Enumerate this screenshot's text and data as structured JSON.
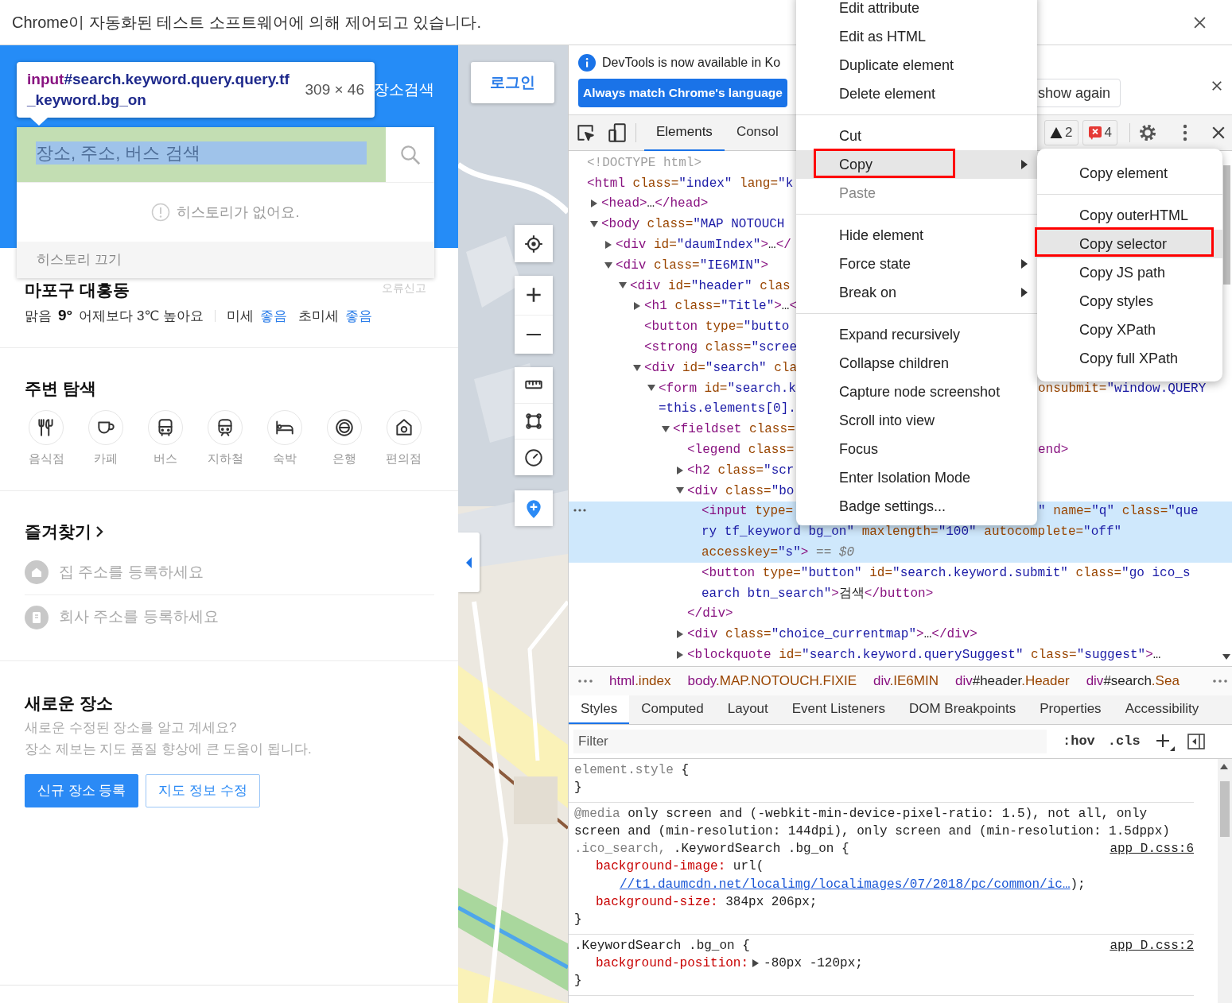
{
  "automation_bar": {
    "message": "Chrome이 자동화된 테스트 소프트웨어에 의해 제어되고 있습니다."
  },
  "place_panel": {
    "header_link": "장소검색",
    "search": {
      "placeholder": "장소, 주소, 버스 검색"
    },
    "history": {
      "message": "히스토리가 없어요.",
      "toggle": "히스토리 끄기"
    },
    "location": {
      "name": "마포구 대흥동",
      "report": "오류신고",
      "weather": "맑음",
      "temperature": "9°",
      "comparison": "어제보다 3℃ 높아요",
      "dust": [
        {
          "label": "미세",
          "value": "좋음"
        },
        {
          "label": "초미세",
          "value": "좋음"
        }
      ]
    },
    "nearby": {
      "title": "주변 탐색",
      "categories": [
        {
          "kind": "restaurant",
          "label": "음식점"
        },
        {
          "kind": "cafe",
          "label": "카페"
        },
        {
          "kind": "bus",
          "label": "버스"
        },
        {
          "kind": "subway",
          "label": "지하철"
        },
        {
          "kind": "lodging",
          "label": "숙박"
        },
        {
          "kind": "bank",
          "label": "은행"
        },
        {
          "kind": "store",
          "label": "편의점"
        }
      ]
    },
    "favorites": {
      "title": "즐겨찾기",
      "items": [
        {
          "kind": "home",
          "label": "집 주소를 등록하세요"
        },
        {
          "kind": "office",
          "label": "회사 주소를 등록하세요"
        }
      ]
    },
    "new_place": {
      "title": "새로운 장소",
      "lines": [
        "새로운 수정된 장소를 알고 계세요?",
        "장소 제보는 지도 품질 향상에 큰 도움이 됩니다."
      ],
      "buttons": [
        {
          "kind": "primary",
          "label": "신규 장소 등록"
        },
        {
          "kind": "outline",
          "label": "지도 정보 수정"
        }
      ]
    }
  },
  "inspect_tooltip": {
    "tag": "input",
    "selector": "#search.keyword.query.query.tf_keyword.bg_on",
    "size": "309 × 46"
  },
  "map": {
    "login": "로그인"
  },
  "devtools": {
    "notice": {
      "message": "DevTools is now available in Ko",
      "primary_button": "Always match Chrome's language",
      "secondary_button": "show again"
    },
    "panel_tabs": [
      {
        "label": "Elements",
        "selected": true
      },
      {
        "label": "Consol",
        "selected": false
      }
    ],
    "issues": {
      "warnings": "2",
      "errors": "4"
    },
    "dom_tree": [
      {
        "segments": [
          {
            "kind": "comment",
            "text": "<!DOCTYPE html>"
          }
        ],
        "selected": false
      },
      {
        "segments": [
          {
            "kind": "tag",
            "text": "<html"
          },
          {
            "kind": "attr",
            "text": " class="
          },
          {
            "kind": "value",
            "text": "\"index\""
          },
          {
            "kind": "attr",
            "text": " lang="
          },
          {
            "kind": "value",
            "text": "\"k"
          }
        ],
        "selected": false,
        "children": [
          {
            "segments": [
              {
                "kind": "tag",
                "text": "<head>"
              },
              {
                "kind": "text",
                "text": "…"
              },
              {
                "kind": "tag",
                "text": "</head>"
              }
            ],
            "expanded": false,
            "selected": false
          },
          {
            "segments": [
              {
                "kind": "tag",
                "text": "<body"
              },
              {
                "kind": "attr",
                "text": " class="
              },
              {
                "kind": "value",
                "text": "\"MAP NOTOUCH"
              }
            ],
            "expanded": true,
            "selected": false,
            "children": [
              {
                "segments": [
                  {
                    "kind": "tag",
                    "text": "<div"
                  },
                  {
                    "kind": "attr",
                    "text": " id="
                  },
                  {
                    "kind": "value",
                    "text": "\"daumIndex\""
                  },
                  {
                    "kind": "tag",
                    "text": ">"
                  },
                  {
                    "kind": "text",
                    "text": "…"
                  },
                  {
                    "kind": "tag",
                    "text": "</"
                  }
                ],
                "expanded": false,
                "selected": false
              },
              {
                "segments": [
                  {
                    "kind": "tag",
                    "text": "<div"
                  },
                  {
                    "kind": "attr",
                    "text": " class="
                  },
                  {
                    "kind": "value",
                    "text": "\"IE6MIN\""
                  },
                  {
                    "kind": "tag",
                    "text": ">"
                  }
                ],
                "expanded": true,
                "selected": false,
                "children": [
                  {
                    "segments": [
                      {
                        "kind": "tag",
                        "text": "<div"
                      },
                      {
                        "kind": "attr",
                        "text": " id="
                      },
                      {
                        "kind": "value",
                        "text": "\"header\""
                      },
                      {
                        "kind": "attr",
                        "text": " clas"
                      }
                    ],
                    "expanded": true,
                    "selected": false,
                    "children": [
                      {
                        "segments": [
                          {
                            "kind": "tag",
                            "text": "<h1"
                          },
                          {
                            "kind": "attr",
                            "text": " class="
                          },
                          {
                            "kind": "value",
                            "text": "\"Title\""
                          },
                          {
                            "kind": "tag",
                            "text": ">"
                          },
                          {
                            "kind": "text",
                            "text": "…"
                          },
                          {
                            "kind": "tag",
                            "text": "<"
                          }
                        ],
                        "expanded": false,
                        "selected": false
                      },
                      {
                        "segments": [
                          {
                            "kind": "tag",
                            "text": "<button"
                          },
                          {
                            "kind": "attr",
                            "text": " type="
                          },
                          {
                            "kind": "value",
                            "text": "\"butto"
                          }
                        ],
                        "selected": false
                      },
                      {
                        "segments": [
                          {
                            "kind": "tag",
                            "text": "<strong"
                          },
                          {
                            "kind": "attr",
                            "text": " class="
                          },
                          {
                            "kind": "value",
                            "text": "\"scree"
                          }
                        ],
                        "selected": false
                      },
                      {
                        "segments": [
                          {
                            "kind": "tag",
                            "text": "<div"
                          },
                          {
                            "kind": "attr",
                            "text": " id="
                          },
                          {
                            "kind": "value",
                            "text": "\"search\""
                          },
                          {
                            "kind": "attr",
                            "text": " cla"
                          }
                        ],
                        "expanded": true,
                        "selected": false,
                        "children": [
                          {
                            "segments": [
                              {
                                "kind": "tag",
                                "text": "<form"
                              },
                              {
                                "kind": "attr",
                                "text": " id="
                              },
                              {
                                "kind": "value",
                                "text": "\"search.k"
                              }
                            ],
                            "right": [
                              {
                                "kind": "attr",
                                "text": "onsubmit="
                              },
                              {
                                "kind": "value",
                                "text": "\"window.QUERY"
                              }
                            ],
                            "more": [
                              [
                                {
                                  "kind": "value",
                                  "text": "=this.elements[0]."
                                }
                              ]
                            ],
                            "expanded": true,
                            "selected": false,
                            "children": [
                              {
                                "segments": [
                                  {
                                    "kind": "tag",
                                    "text": "<fieldset"
                                  },
                                  {
                                    "kind": "attr",
                                    "text": " class="
                                  }
                                ],
                                "expanded": true,
                                "selected": false,
                                "children": [
                                  {
                                    "segments": [
                                      {
                                        "kind": "tag",
                                        "text": "<legend"
                                      },
                                      {
                                        "kind": "attr",
                                        "text": " class="
                                      }
                                    ],
                                    "right": [
                                      {
                                        "kind": "tag",
                                        "text": "end>"
                                      }
                                    ],
                                    "selected": false
                                  },
                                  {
                                    "segments": [
                                      {
                                        "kind": "tag",
                                        "text": "<h2"
                                      },
                                      {
                                        "kind": "attr",
                                        "text": " class="
                                      },
                                      {
                                        "kind": "value",
                                        "text": "\"scr"
                                      }
                                    ],
                                    "expanded": false,
                                    "selected": false
                                  },
                                  {
                                    "segments": [
                                      {
                                        "kind": "tag",
                                        "text": "<div"
                                      },
                                      {
                                        "kind": "attr",
                                        "text": " class="
                                      },
                                      {
                                        "kind": "value",
                                        "text": "\"bo"
                                      }
                                    ],
                                    "expanded": true,
                                    "selected": false,
                                    "children": [
                                      {
                                        "segments": [
                                          {
                                            "kind": "tag",
                                            "text": "<input"
                                          },
                                          {
                                            "kind": "attr",
                                            "text": " type="
                                          }
                                        ],
                                        "right": [
                                          {
                                            "kind": "value",
                                            "text": "\""
                                          },
                                          {
                                            "kind": "attr",
                                            "text": " name="
                                          },
                                          {
                                            "kind": "value",
                                            "text": "\"q\""
                                          },
                                          {
                                            "kind": "attr",
                                            "text": " class="
                                          },
                                          {
                                            "kind": "value",
                                            "text": "\"que"
                                          }
                                        ],
                                        "more": [
                                          [
                                            {
                                              "kind": "value",
                                              "text": "ry tf_keyword bg_on\""
                                            },
                                            {
                                              "kind": "attr",
                                              "text": " maxlength="
                                            },
                                            {
                                              "kind": "value",
                                              "text": "\"100\""
                                            },
                                            {
                                              "kind": "attr",
                                              "text": " autocomplete="
                                            },
                                            {
                                              "kind": "value",
                                              "text": "\"off\""
                                            }
                                          ],
                                          [
                                            {
                                              "kind": "attr",
                                              "text": "accesskey="
                                            },
                                            {
                                              "kind": "value",
                                              "text": "\"s\""
                                            },
                                            {
                                              "kind": "tag",
                                              "text": ">"
                                            },
                                            {
                                              "kind": "hint",
                                              "text": " == $0"
                                            }
                                          ]
                                        ],
                                        "selected": true
                                      },
                                      {
                                        "segments": [
                                          {
                                            "kind": "tag",
                                            "text": "<button"
                                          },
                                          {
                                            "kind": "attr",
                                            "text": " type="
                                          },
                                          {
                                            "kind": "value",
                                            "text": "\"button\""
                                          },
                                          {
                                            "kind": "attr",
                                            "text": " id="
                                          },
                                          {
                                            "kind": "value",
                                            "text": "\"search.keyword.submit\""
                                          },
                                          {
                                            "kind": "attr",
                                            "text": " class="
                                          },
                                          {
                                            "kind": "value",
                                            "text": "\"go ico_s"
                                          }
                                        ],
                                        "more": [
                                          [
                                            {
                                              "kind": "value",
                                              "text": "earch btn_search\""
                                            },
                                            {
                                              "kind": "tag",
                                              "text": ">"
                                            },
                                            {
                                              "kind": "text",
                                              "text": "검색"
                                            },
                                            {
                                              "kind": "tag",
                                              "text": "</button>"
                                            }
                                          ]
                                        ],
                                        "selected": false
                                      }
                                    ],
                                    "close": [
                                      {
                                        "kind": "tag",
                                        "text": "</div>"
                                      }
                                    ]
                                  },
                                  {
                                    "segments": [
                                      {
                                        "kind": "tag",
                                        "text": "<div"
                                      },
                                      {
                                        "kind": "attr",
                                        "text": " class="
                                      },
                                      {
                                        "kind": "value",
                                        "text": "\"choice_currentmap\""
                                      },
                                      {
                                        "kind": "tag",
                                        "text": ">"
                                      },
                                      {
                                        "kind": "text",
                                        "text": "…"
                                      },
                                      {
                                        "kind": "tag",
                                        "text": "</div>"
                                      }
                                    ],
                                    "expanded": false,
                                    "selected": false
                                  },
                                  {
                                    "segments": [
                                      {
                                        "kind": "tag",
                                        "text": "<blockquote"
                                      },
                                      {
                                        "kind": "attr",
                                        "text": " id="
                                      },
                                      {
                                        "kind": "value",
                                        "text": "\"search.keyword.querySuggest\""
                                      },
                                      {
                                        "kind": "attr",
                                        "text": " class="
                                      },
                                      {
                                        "kind": "value",
                                        "text": "\"suggest\""
                                      },
                                      {
                                        "kind": "tag",
                                        "text": ">"
                                      },
                                      {
                                        "kind": "text",
                                        "text": "…"
                                      }
                                    ],
                                    "expanded": false,
                                    "selected": false
                                  }
                                ]
                              }
                            ]
                          }
                        ]
                      }
                    ]
                  }
                ]
              }
            ]
          }
        ]
      }
    ],
    "breadcrumbs": [
      "html.index",
      "body.MAP.NOTOUCH.FIXIE",
      "div.IE6MIN",
      "div#header.Header",
      "div#search.Sea"
    ],
    "sidebar_tabs": [
      {
        "label": "Styles",
        "selected": true
      },
      {
        "label": "Computed",
        "selected": false
      },
      {
        "label": "Layout",
        "selected": false
      },
      {
        "label": "Event Listeners",
        "selected": false
      },
      {
        "label": "DOM Breakpoints",
        "selected": false
      },
      {
        "label": "Properties",
        "selected": false
      },
      {
        "label": "Accessibility",
        "selected": false
      }
    ],
    "filter": {
      "placeholder": "Filter"
    },
    "style_toggles": [
      ":hov",
      ".cls"
    ],
    "rules": [
      {
        "selectors": [
          {
            "text": "element.style",
            "matched": false
          }
        ],
        "open": " {",
        "close": "}"
      },
      {
        "media_keyword": "@media",
        "media": " only screen and (-webkit-min-device-pixel-ratio: 1.5), not all, only screen and (min-resolution: 144dpi), only screen and (min-resolution: 1.5dppx)",
        "selectors": [
          {
            "text": ".ico_search,",
            "matched": false
          },
          {
            "text": " .KeywordSearch .bg_on",
            "matched": true
          }
        ],
        "open": " {",
        "source": "app_D.css:6",
        "declarations": [
          {
            "property": "background-image:",
            "value": "url(",
            "url": "//t1.daumcdn.net/localimg/localimages/07/2018/pc/common/ic…",
            "value_end": ");",
            "shorthand": false
          },
          {
            "property": "background-size:",
            "value": "384px 206px;",
            "shorthand": false
          }
        ],
        "close": "}"
      },
      {
        "selectors": [
          {
            "text": ".KeywordSearch .bg_on",
            "matched": true
          }
        ],
        "open": " {",
        "source": "app_D.css:2",
        "declarations": [
          {
            "property": "background-position:",
            "value": "-80px -120px;",
            "shorthand": true
          }
        ],
        "close": "}"
      }
    ]
  },
  "context_menu": {
    "groups": [
      [
        {
          "label": "Edit attribute",
          "highlighted": false,
          "disabled": false,
          "submenu": false,
          "outlined": false
        },
        {
          "label": "Edit as HTML",
          "highlighted": false,
          "disabled": false,
          "submenu": false,
          "outlined": false
        },
        {
          "label": "Duplicate element",
          "highlighted": false,
          "disabled": false,
          "submenu": false,
          "outlined": false
        },
        {
          "label": "Delete element",
          "highlighted": false,
          "disabled": false,
          "submenu": false,
          "outlined": false
        }
      ],
      [
        {
          "label": "Cut",
          "highlighted": false,
          "disabled": false,
          "submenu": false,
          "outlined": false
        },
        {
          "label": "Copy",
          "highlighted": true,
          "disabled": false,
          "submenu": true,
          "outlined": true
        },
        {
          "label": "Paste",
          "highlighted": false,
          "disabled": true,
          "submenu": false,
          "outlined": false
        }
      ],
      [
        {
          "label": "Hide element",
          "highlighted": false,
          "disabled": false,
          "submenu": false,
          "outlined": false
        },
        {
          "label": "Force state",
          "highlighted": false,
          "disabled": false,
          "submenu": true,
          "outlined": false
        },
        {
          "label": "Break on",
          "highlighted": false,
          "disabled": false,
          "submenu": true,
          "outlined": false
        }
      ],
      [
        {
          "label": "Expand recursively",
          "highlighted": false,
          "disabled": false,
          "submenu": false,
          "outlined": false
        },
        {
          "label": "Collapse children",
          "highlighted": false,
          "disabled": false,
          "submenu": false,
          "outlined": false
        },
        {
          "label": "Capture node screenshot",
          "highlighted": false,
          "disabled": false,
          "submenu": false,
          "outlined": false
        },
        {
          "label": "Scroll into view",
          "highlighted": false,
          "disabled": false,
          "submenu": false,
          "outlined": false
        },
        {
          "label": "Focus",
          "highlighted": false,
          "disabled": false,
          "submenu": false,
          "outlined": false
        },
        {
          "label": "Enter Isolation Mode",
          "highlighted": false,
          "disabled": false,
          "submenu": false,
          "outlined": false
        },
        {
          "label": "Badge settings...",
          "highlighted": false,
          "disabled": false,
          "submenu": false,
          "outlined": false
        }
      ]
    ]
  },
  "copy_submenu": {
    "groups": [
      [
        {
          "label": "Copy element",
          "highlighted": false,
          "disabled": false,
          "submenu": false,
          "outlined": false
        }
      ],
      [
        {
          "label": "Copy outerHTML",
          "highlighted": false,
          "disabled": false,
          "submenu": false,
          "outlined": false
        },
        {
          "label": "Copy selector",
          "highlighted": true,
          "disabled": false,
          "submenu": false,
          "outlined": true
        },
        {
          "label": "Copy JS path",
          "highlighted": false,
          "disabled": false,
          "submenu": false,
          "outlined": false
        },
        {
          "label": "Copy styles",
          "highlighted": false,
          "disabled": false,
          "submenu": false,
          "outlined": false
        },
        {
          "label": "Copy XPath",
          "highlighted": false,
          "disabled": false,
          "submenu": false,
          "outlined": false
        },
        {
          "label": "Copy full XPath",
          "highlighted": false,
          "disabled": false,
          "submenu": false,
          "outlined": false
        }
      ]
    ]
  }
}
